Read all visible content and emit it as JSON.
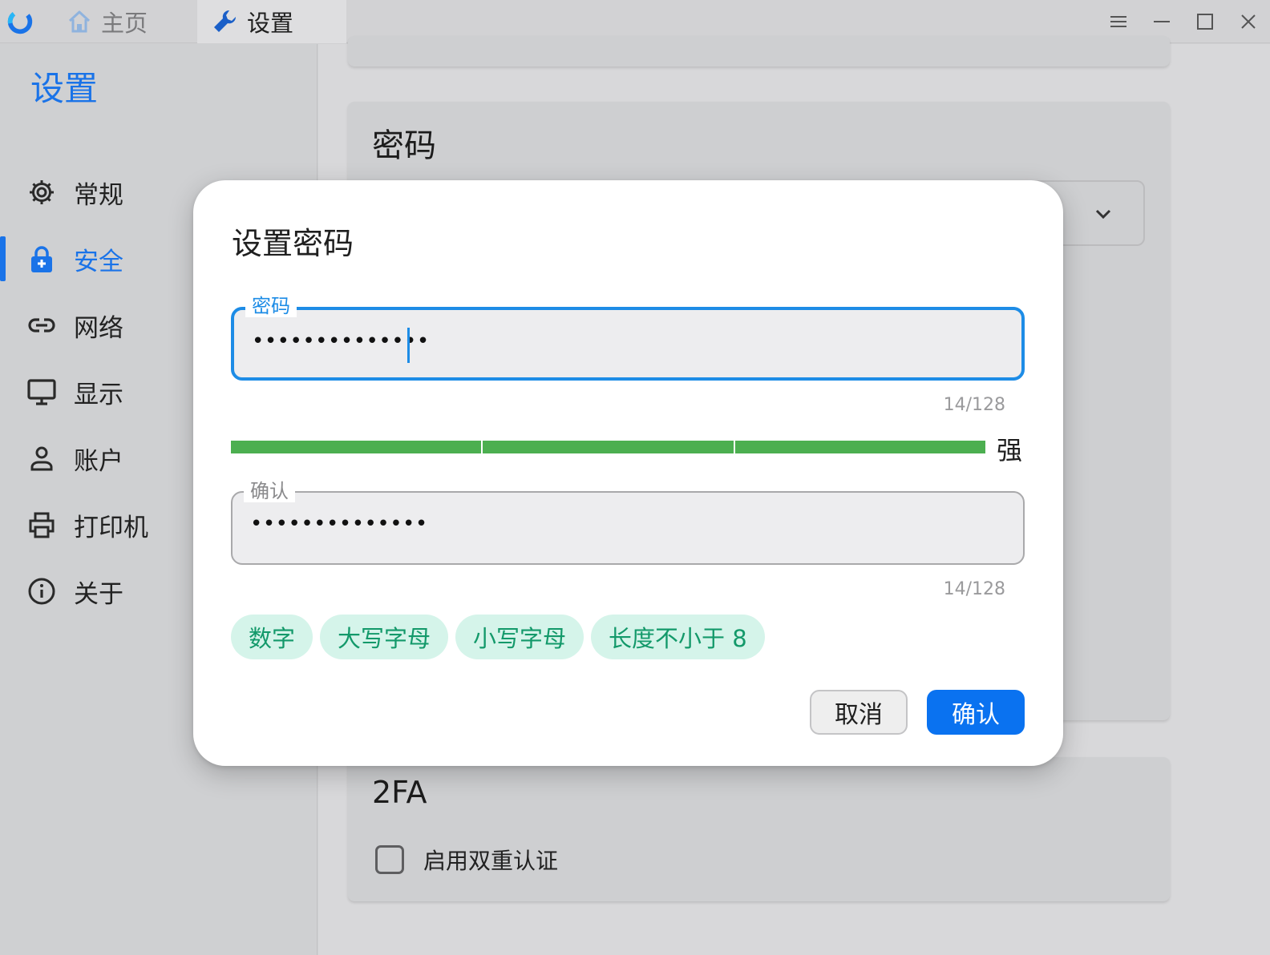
{
  "titlebar": {
    "tabs": [
      {
        "label": "主页",
        "icon": "home-icon"
      },
      {
        "label": "设置",
        "icon": "wrench-icon"
      }
    ],
    "controls": [
      "menu-icon",
      "minimize-icon",
      "maximize-icon",
      "close-icon"
    ]
  },
  "sidebar": {
    "title": "设置",
    "items": [
      {
        "label": "常规",
        "icon": "gear-icon"
      },
      {
        "label": "安全",
        "icon": "lock-icon",
        "active": true
      },
      {
        "label": "网络",
        "icon": "link-icon"
      },
      {
        "label": "显示",
        "icon": "monitor-icon"
      },
      {
        "label": "账户",
        "icon": "user-icon"
      },
      {
        "label": "打印机",
        "icon": "printer-icon"
      },
      {
        "label": "关于",
        "icon": "info-icon"
      }
    ]
  },
  "main": {
    "password_card": {
      "title": "密码"
    },
    "twofa_card": {
      "title": "2FA",
      "checkbox_label": "启用双重认证",
      "checked": false
    }
  },
  "dialog": {
    "title": "设置密码",
    "password": {
      "label": "密码",
      "value": "••••••••••••••",
      "counter": "14/128"
    },
    "strength": {
      "label": "强",
      "level": 1.0,
      "segments": 3
    },
    "confirm": {
      "label": "确认",
      "value": "••••••••••••••",
      "counter": "14/128"
    },
    "requirements": [
      "数字",
      "大写字母",
      "小写字母",
      "长度不小于 8"
    ],
    "cancel_label": "取消",
    "ok_label": "确认"
  },
  "colors": {
    "accent": "#1a73e8",
    "primary_button": "#0a72f0",
    "strength_bar": "#4caf50",
    "chip_bg": "#d5f4ea",
    "chip_text": "#13996a"
  }
}
